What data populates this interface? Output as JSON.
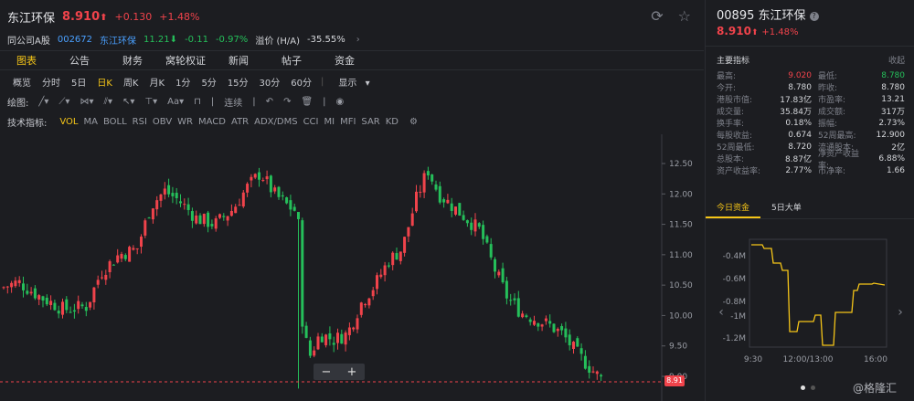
{
  "header": {
    "name": "东江环保",
    "price": "8.910",
    "arrow": "⬆",
    "change": "+0.130",
    "change_pct": "+1.48%"
  },
  "peer": {
    "label": "同公司A股",
    "code": "002672",
    "name": "东江环保",
    "price": "11.21",
    "arrow": "⬇",
    "change": "-0.11",
    "change_pct": "-0.97%",
    "premium_label": "溢价 (H/A)",
    "premium": "-35.55%"
  },
  "tabs": [
    "图表",
    "公告",
    "财务",
    "窝轮权证",
    "新闻",
    "帖子",
    "资金"
  ],
  "periods": [
    "概览",
    "分时",
    "5日",
    "日K",
    "周K",
    "月K",
    "1分",
    "5分",
    "15分",
    "30分",
    "60分",
    "显示"
  ],
  "draw": {
    "label": "绘图:",
    "link": "连续"
  },
  "indicators": {
    "label": "技术指标:",
    "items": [
      "VOL",
      "MA",
      "BOLL",
      "RSI",
      "OBV",
      "WR",
      "MACD",
      "ATR",
      "ADX/DMS",
      "CCI",
      "MI",
      "MFI",
      "SAR",
      "KD"
    ]
  },
  "chart_data": {
    "type": "candlestick",
    "y_ticks": [
      "12.50",
      "12.00",
      "11.50",
      "11.00",
      "10.50",
      "10.00",
      "9.50",
      "9.00"
    ],
    "y_range": [
      9.0,
      12.5
    ],
    "last_price": "8.91",
    "up_color": "#f0434b",
    "down_color": "#25bf5a"
  },
  "zoom": {
    "minus": "−",
    "plus": "+"
  },
  "right": {
    "code_title": "00895 东江环保",
    "price": "8.910",
    "arrow": "⬆",
    "change_pct": "+1.48%",
    "main_label": "主要指标",
    "collapse": "收起",
    "stats": [
      [
        "最高:",
        "9.020",
        "最低:",
        "8.780"
      ],
      [
        "今开:",
        "8.780",
        "昨收:",
        "8.780"
      ],
      [
        "港股市值:",
        "17.83亿",
        "市盈率:",
        "13.21"
      ],
      [
        "成交量:",
        "35.84万",
        "成交额:",
        "317万"
      ],
      [
        "换手率:",
        "0.18%",
        "振幅:",
        "2.73%"
      ],
      [
        "每股收益:",
        "0.674",
        "52周最高:",
        "12.900"
      ],
      [
        "52周最低:",
        "8.720",
        "流通股本:",
        "2亿"
      ],
      [
        "总股本:",
        "8.87亿",
        "净资产收益率:",
        "6.88%"
      ],
      [
        "资产收益率:",
        "2.77%",
        "市净率:",
        "1.66"
      ]
    ],
    "fund_tabs": [
      "今日资金",
      "5日大单"
    ],
    "fund_chart": {
      "y_ticks": [
        "-0.4M",
        "-0.6M",
        "-0.8M",
        "-1M",
        "-1.2M"
      ],
      "x_ticks": [
        "9:30",
        "12:00/13:00",
        "16:00"
      ]
    },
    "watermark": "@格隆汇"
  }
}
